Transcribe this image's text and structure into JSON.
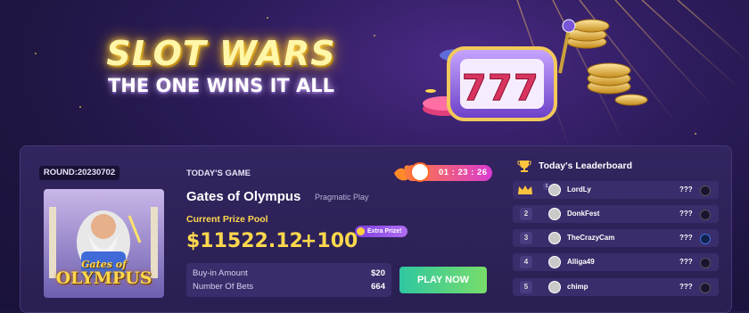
{
  "hero": {
    "title": "SLOT WARS",
    "subtitle": "THE ONE WINS IT ALL"
  },
  "round": {
    "label": "ROUND:20230702"
  },
  "game": {
    "section_label": "TODAY'S GAME",
    "name": "Gates of Olympus",
    "provider": "Pragmatic Play",
    "thumb_title": "Gates of",
    "thumb_subtitle": "OLYMPUS",
    "prize_label": "Current Prize Pool",
    "prize_amount": "$11522.12",
    "prize_extra": "+100",
    "extra_badge": "Extra Prize!",
    "buyin_label": "Buy-in Amount",
    "buyin_value": "$20",
    "bets_label": "Number Of Bets",
    "bets_value": "664",
    "play_label": "PLAY NOW"
  },
  "timer": {
    "value": "01 : 23 : 26"
  },
  "leaderboard": {
    "title": "Today's Leaderboard",
    "rows": [
      {
        "rank": "1",
        "name": "LordLy",
        "score": "???",
        "icon": "crown-icon"
      },
      {
        "rank": "2",
        "name": "DonkFest",
        "score": "???",
        "icon": "chip-icon"
      },
      {
        "rank": "3",
        "name": "TheCrazyCam",
        "score": "???",
        "icon": "link-icon"
      },
      {
        "rank": "4",
        "name": "Alliga49",
        "score": "???",
        "icon": "chip-icon"
      },
      {
        "rank": "5",
        "name": "chimp",
        "score": "???",
        "icon": "chip-icon"
      }
    ]
  },
  "colors": {
    "background": "#1e1540",
    "panel": "#2a1f52",
    "gold": "#ffd84d",
    "play_button": "#2fc7a0",
    "timer": "#d93bd0"
  }
}
